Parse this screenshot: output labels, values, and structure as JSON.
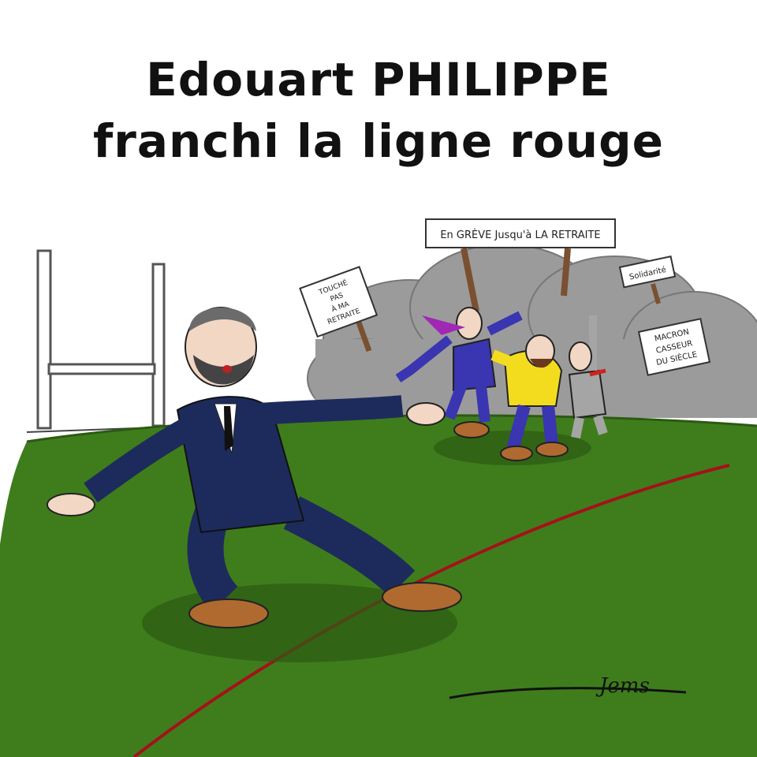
{
  "title": {
    "line1": "Edouart PHILIPPE",
    "line2": "franchi la ligne rouge"
  },
  "signs": {
    "banner": "En GRÈVE Jusqu'à LA RETRAITE",
    "left_line1": "TOUCHÉ",
    "left_line2": "PAS",
    "left_line3": "À MA",
    "left_line4": "RETRAITE",
    "right_small": "Solidarité",
    "right_line1": "MACRON",
    "right_line2": "CASSEUR",
    "right_line3": "DU SIÈCLE"
  },
  "signature": "Jems",
  "colors": {
    "field": "#3f7d1c",
    "red_line": "#a3121b",
    "suit": "#1d2b5c",
    "smoke": "#9a9a9a",
    "yellow_shirt": "#f3dc1e",
    "purple_coat": "#3a35b0"
  },
  "icons": [
    "rugby-goalpost-icon",
    "smoke-cloud-icon"
  ]
}
